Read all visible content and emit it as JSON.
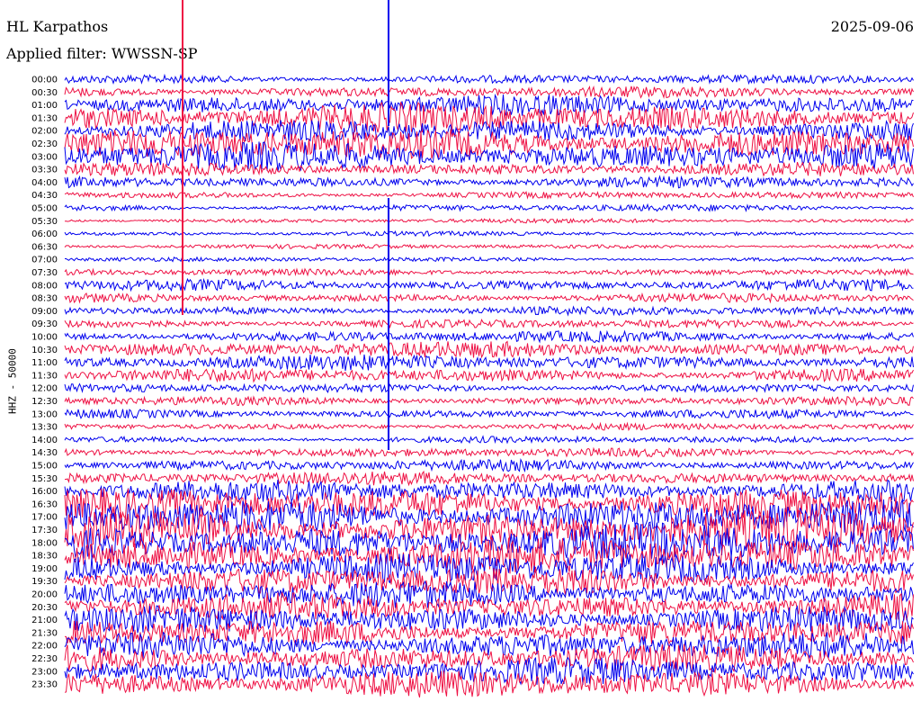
{
  "header": {
    "station": "HL Karpathos",
    "date": "2025-09-06",
    "filter": "Applied filter: WWSSN-SP"
  },
  "y_axis_label": "HHZ - 50000",
  "colors": {
    "trace_a": "#0000ee",
    "trace_b": "#ee1144",
    "background": "#ffffff"
  },
  "chart_data": {
    "type": "helicorder",
    "title": "HL Karpathos",
    "ylabel": "HHZ - 50000",
    "rows": [
      {
        "label": "00:00",
        "amp": 4
      },
      {
        "label": "00:30",
        "amp": 5
      },
      {
        "label": "01:00",
        "amp": 9
      },
      {
        "label": "01:30",
        "amp": 13
      },
      {
        "label": "02:00",
        "amp": 10
      },
      {
        "label": "02:30",
        "amp": 14
      },
      {
        "label": "03:00",
        "amp": 13
      },
      {
        "label": "03:30",
        "amp": 6
      },
      {
        "label": "04:00",
        "amp": 5
      },
      {
        "label": "04:30",
        "amp": 3
      },
      {
        "label": "05:00",
        "amp": 3
      },
      {
        "label": "05:30",
        "amp": 2
      },
      {
        "label": "06:00",
        "amp": 2
      },
      {
        "label": "06:30",
        "amp": 2
      },
      {
        "label": "07:00",
        "amp": 2
      },
      {
        "label": "07:30",
        "amp": 3
      },
      {
        "label": "08:00",
        "amp": 5
      },
      {
        "label": "08:30",
        "amp": 4
      },
      {
        "label": "09:00",
        "amp": 4
      },
      {
        "label": "09:30",
        "amp": 4
      },
      {
        "label": "10:00",
        "amp": 5
      },
      {
        "label": "10:30",
        "amp": 7
      },
      {
        "label": "11:00",
        "amp": 7
      },
      {
        "label": "11:30",
        "amp": 6
      },
      {
        "label": "12:00",
        "amp": 4
      },
      {
        "label": "12:30",
        "amp": 4
      },
      {
        "label": "13:00",
        "amp": 4
      },
      {
        "label": "13:30",
        "amp": 3
      },
      {
        "label": "14:00",
        "amp": 3
      },
      {
        "label": "14:30",
        "amp": 4
      },
      {
        "label": "15:00",
        "amp": 5
      },
      {
        "label": "15:30",
        "amp": 6
      },
      {
        "label": "16:00",
        "amp": 10
      },
      {
        "label": "16:30",
        "amp": 14
      },
      {
        "label": "17:00",
        "amp": 16
      },
      {
        "label": "17:30",
        "amp": 17
      },
      {
        "label": "18:00",
        "amp": 17
      },
      {
        "label": "18:30",
        "amp": 16
      },
      {
        "label": "19:00",
        "amp": 14
      },
      {
        "label": "19:30",
        "amp": 13
      },
      {
        "label": "20:00",
        "amp": 12
      },
      {
        "label": "20:30",
        "amp": 12
      },
      {
        "label": "21:00",
        "amp": 12
      },
      {
        "label": "21:30",
        "amp": 12
      },
      {
        "label": "22:00",
        "amp": 12
      },
      {
        "label": "22:30",
        "amp": 12
      },
      {
        "label": "23:00",
        "amp": 12
      },
      {
        "label": "23:30",
        "amp": 12
      }
    ]
  }
}
